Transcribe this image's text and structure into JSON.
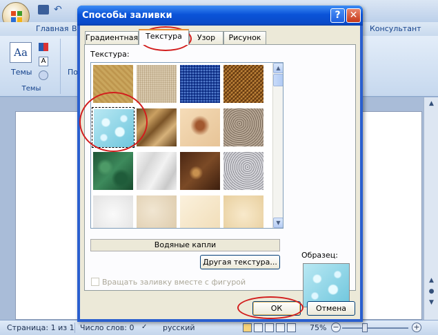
{
  "app": {
    "ribbon_tabs": [
      "Главная",
      "В",
      "Консультант"
    ],
    "ribbon_groups": {
      "themes_label": "Темы",
      "themes_button": "Темы",
      "page_setup_fragment": "По"
    }
  },
  "dialog": {
    "title": "Способы заливки",
    "help_glyph": "?",
    "close_glyph": "✕",
    "tabs": [
      {
        "label": "Градиентная",
        "active": false
      },
      {
        "label": "Текстура",
        "active": true
      },
      {
        "label": "Узор",
        "active": false
      },
      {
        "label": "Рисунок",
        "active": false
      }
    ],
    "texture_label": "Текстура:",
    "textures": [
      "t0",
      "t1",
      "t2",
      "t3",
      "t4",
      "t5",
      "t6",
      "t7",
      "t8",
      "t9",
      "t10",
      "t11",
      "t12",
      "t13",
      "t14",
      "t15"
    ],
    "selected_texture_name": "Водяные капли",
    "other_texture_button": "Другая текстура...",
    "rotate_with_shape": "Вращать заливку вместе с фигурой",
    "sample_label": "Образец:",
    "ok": "ОК",
    "cancel": "Отмена"
  },
  "statusbar": {
    "page": "Страница: 1 из 1",
    "words": "Число слов: 0",
    "language": "русский",
    "zoom": "75%",
    "zoom_minus": "−",
    "zoom_plus": "+"
  },
  "colors": {
    "annotation": "#d21d1d",
    "title_bar": "#0a53d8",
    "dialog_bg": "#ece9d8"
  }
}
